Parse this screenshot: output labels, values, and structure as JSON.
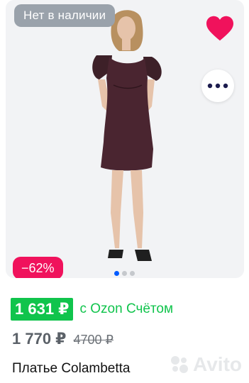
{
  "product_card": {
    "availability_badge": "Нет в наличии",
    "discount_badge": "−62%",
    "favorite_icon": "heart-icon",
    "more_icon": "more-dots-icon",
    "favorite_color": "#f0125c",
    "gallery": {
      "total_images": 3,
      "active_index": 0
    }
  },
  "pricing": {
    "card_price": "1 631 ₽",
    "card_price_label": "с Ozon Счётом",
    "regular_price": "1 770 ₽",
    "original_price": "4700 ₽",
    "green_color": "#10c44c"
  },
  "title": "Платье Colambetta",
  "watermark": {
    "text": "Avito"
  }
}
